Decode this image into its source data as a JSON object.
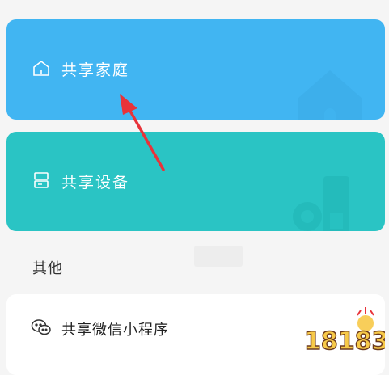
{
  "cards": {
    "home": {
      "label": "共享家庭",
      "icon": "home-icon",
      "color": "#41b5f2"
    },
    "device": {
      "label": "共享设备",
      "icon": "device-icon",
      "color": "#2ac4c4"
    }
  },
  "section": {
    "title": "其他"
  },
  "list": {
    "items": [
      {
        "label": "共享微信小程序",
        "icon": "wechat-icon"
      }
    ]
  },
  "watermark": {
    "text": "18183"
  },
  "annotation": {
    "color": "#e8333a"
  }
}
